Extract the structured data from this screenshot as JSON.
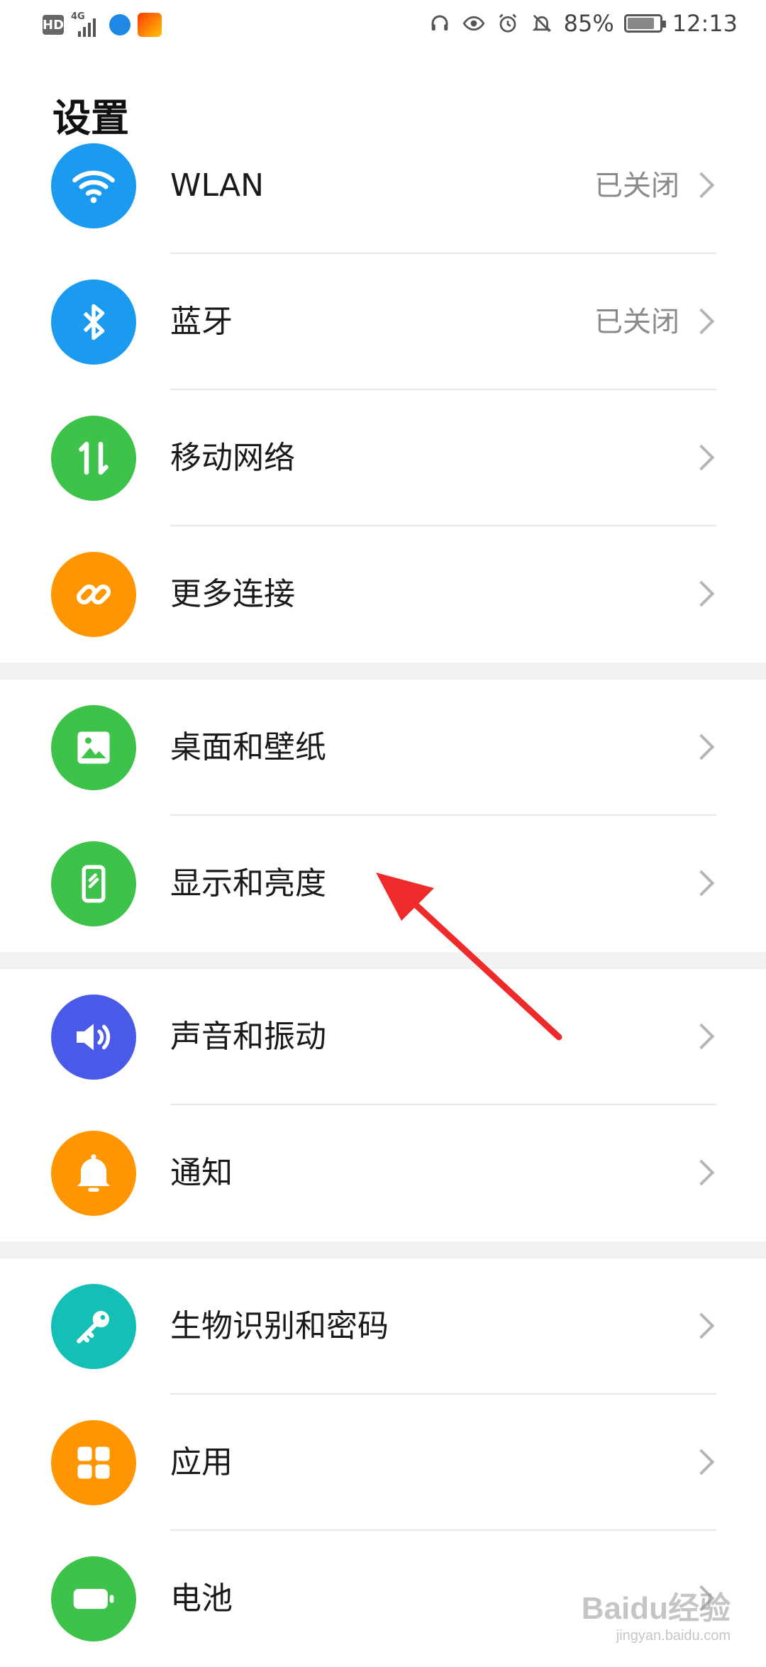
{
  "status_bar": {
    "network_type": "4G",
    "hd_badge": "HD",
    "battery_percent": "85%",
    "battery_level": 0.85,
    "time": "12:13",
    "icons": [
      "headphones-icon",
      "eye-icon",
      "alarm-icon",
      "mute-bell-icon",
      "battery-icon"
    ]
  },
  "page": {
    "title": "设置"
  },
  "sections": [
    {
      "items": [
        {
          "id": "wlan",
          "label": "WLAN",
          "value": "已关闭",
          "icon": "wifi-icon",
          "color": "#1a9bf0"
        },
        {
          "id": "bluetooth",
          "label": "蓝牙",
          "value": "已关闭",
          "icon": "bluetooth-icon",
          "color": "#1a9bf0"
        },
        {
          "id": "mobile-network",
          "label": "移动网络",
          "value": "",
          "icon": "mobile-data-icon",
          "color": "#3ec34a"
        },
        {
          "id": "more-connections",
          "label": "更多连接",
          "value": "",
          "icon": "link-icon",
          "color": "#ff9500"
        }
      ]
    },
    {
      "items": [
        {
          "id": "wallpaper",
          "label": "桌面和壁纸",
          "value": "",
          "icon": "image-icon",
          "color": "#3ec34a"
        },
        {
          "id": "display",
          "label": "显示和亮度",
          "value": "",
          "icon": "phone-display-icon",
          "color": "#3ec34a"
        }
      ]
    },
    {
      "items": [
        {
          "id": "sound",
          "label": "声音和振动",
          "value": "",
          "icon": "speaker-icon",
          "color": "#4a5ae8"
        },
        {
          "id": "notifications",
          "label": "通知",
          "value": "",
          "icon": "bell-icon",
          "color": "#ff9500"
        }
      ]
    },
    {
      "items": [
        {
          "id": "biometrics",
          "label": "生物识别和密码",
          "value": "",
          "icon": "key-icon",
          "color": "#14bfb6"
        },
        {
          "id": "apps",
          "label": "应用",
          "value": "",
          "icon": "apps-grid-icon",
          "color": "#ff9500"
        },
        {
          "id": "battery",
          "label": "电池",
          "value": "",
          "icon": "battery-icon",
          "color": "#3ec34a"
        }
      ]
    }
  ],
  "annotation": {
    "color": "#ee2a2a"
  },
  "watermark": {
    "brand": "Baidu经验",
    "domain": "jingyan.baidu.com"
  }
}
